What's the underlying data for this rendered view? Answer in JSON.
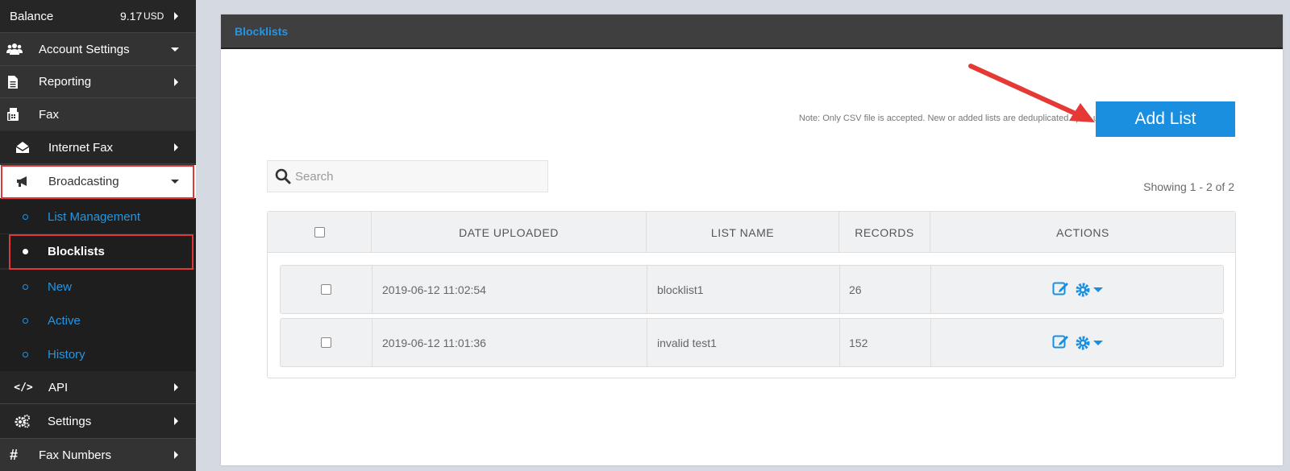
{
  "sidebar": {
    "balance_label": "Balance",
    "balance_value": "9.17",
    "balance_currency": "USD",
    "items": [
      {
        "label": "Account Settings",
        "icon": "users-icon"
      },
      {
        "label": "Reporting",
        "icon": "file-icon"
      },
      {
        "label": "Fax",
        "icon": "fax-icon"
      },
      {
        "label": "Internet Fax",
        "icon": "envelope-open-icon"
      },
      {
        "label": "Broadcasting",
        "icon": "bullhorn-icon"
      },
      {
        "label": "List Management"
      },
      {
        "label": "Blocklists"
      },
      {
        "label": "New"
      },
      {
        "label": "Active"
      },
      {
        "label": "History"
      },
      {
        "label": "API",
        "icon": "code-icon"
      },
      {
        "label": "Settings",
        "icon": "gears-icon"
      },
      {
        "label": "Fax Numbers",
        "icon": "hashtag-icon"
      }
    ]
  },
  "panel": {
    "title": "Blocklists",
    "note": "Note: Only CSV file is accepted. New or added lists are deduplicated upon upload.",
    "add_button": "Add List",
    "search_placeholder": "Search",
    "showing": "Showing 1 - 2 of 2"
  },
  "table": {
    "headers": [
      "DATE UPLOADED",
      "LIST NAME",
      "RECORDS",
      "ACTIONS"
    ],
    "rows": [
      {
        "date": "2019-06-12 11:02:54",
        "name": "blocklist1",
        "records": "26"
      },
      {
        "date": "2019-06-12 11:01:36",
        "name": "invalid test1",
        "records": "152"
      }
    ]
  },
  "colors": {
    "accent": "#1a8fe0",
    "highlight_box": "#e0373b",
    "sidebar_bg": "#2d2d2d"
  }
}
